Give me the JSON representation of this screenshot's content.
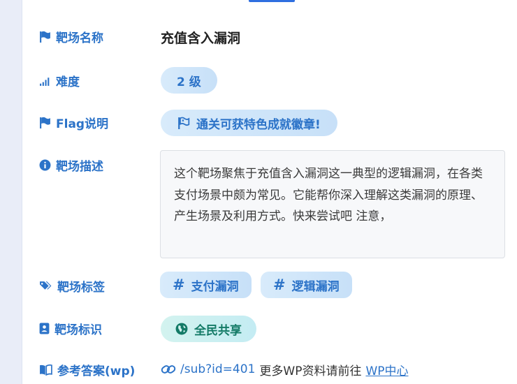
{
  "labels": {
    "name": "靶场名称",
    "difficulty": "难度",
    "flag": "Flag说明",
    "description": "靶场描述",
    "tags": "靶场标签",
    "identity": "靶场标识",
    "answer": "参考答案(wp)"
  },
  "values": {
    "name": "充值含入漏洞",
    "difficulty": "2 级",
    "flag": "通关可获特色成就徽章!",
    "description": "这个靶场聚焦于充值含入漏洞这一典型的逻辑漏洞，在各类支付场景中颇为常见。它能帮你深入理解这类漏洞的原理、产生场景及利用方式。快来尝试吧 注意，",
    "tags": [
      "支付漏洞",
      "逻辑漏洞"
    ],
    "identity": "全民共享",
    "answer_link": "/sub?id=401",
    "answer_text": "更多WP资料请前往",
    "answer_center": "WP中心"
  },
  "icons": {
    "name": "flag-icon",
    "difficulty": "signal-bars-icon",
    "flag": "flag-icon",
    "description": "info-circle-icon",
    "tags": "tags-icon",
    "identity": "id-badge-icon",
    "answer": "book-open-icon",
    "flag_pill": "flag-outline-icon",
    "tag_pill": "hashtag-icon",
    "identity_pill": "globe-icon",
    "answer_link": "link-icon"
  },
  "colors": {
    "accent": "#2c73c8",
    "green": "#137a66",
    "pill_blue": "#d8ebfb",
    "pill_green": "#d3f3ef"
  }
}
